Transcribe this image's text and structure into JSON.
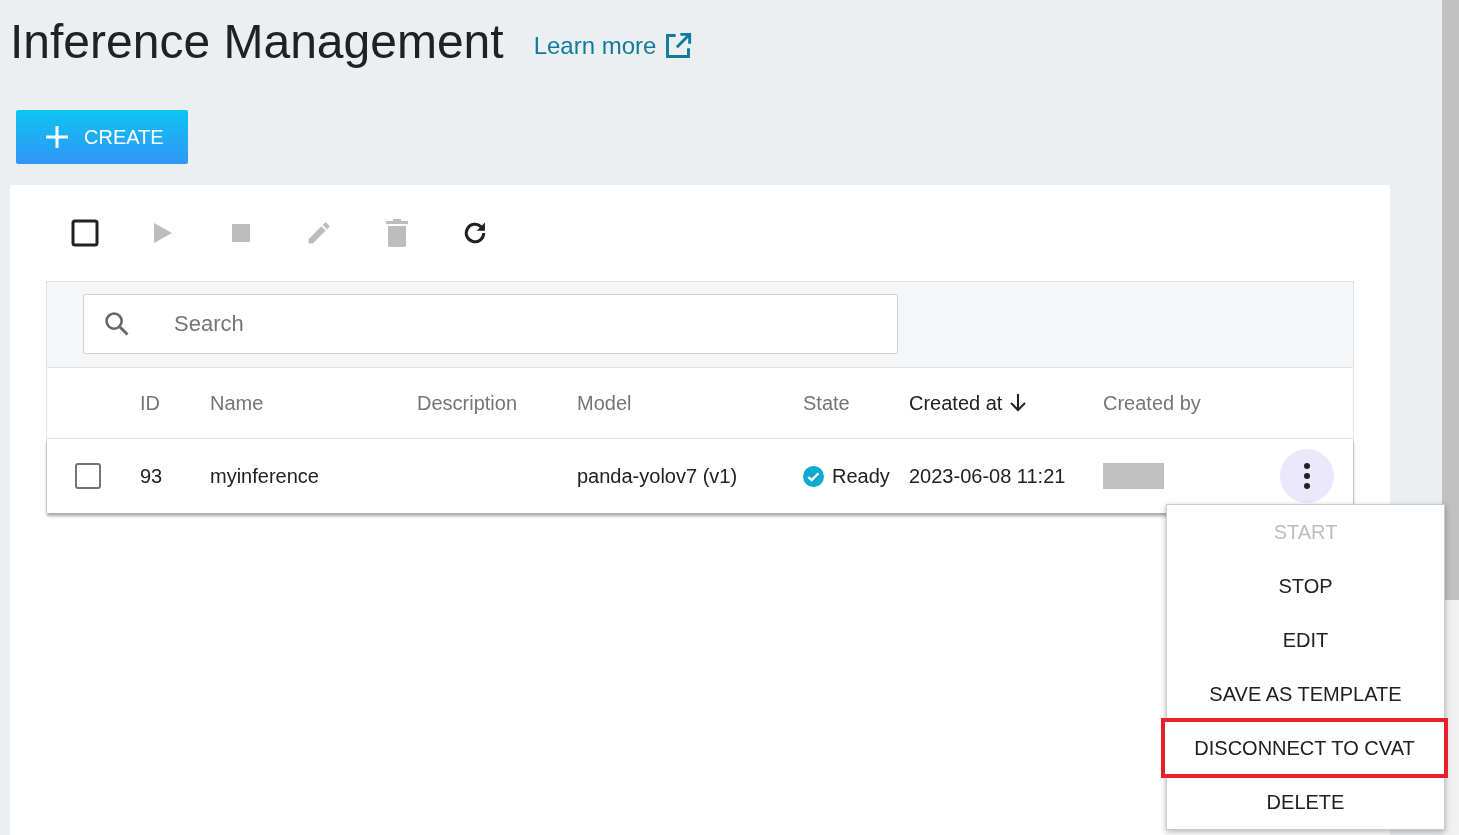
{
  "page": {
    "title": "Inference Management",
    "learn_more": "Learn more"
  },
  "create_button": {
    "label": "CREATE"
  },
  "toolbar": [
    {
      "kind": "checkbox",
      "disabled": false
    },
    {
      "kind": "start",
      "disabled": true
    },
    {
      "kind": "stop",
      "disabled": true
    },
    {
      "kind": "edit",
      "disabled": true
    },
    {
      "kind": "delete",
      "disabled": true
    },
    {
      "kind": "refresh",
      "disabled": false
    }
  ],
  "search": {
    "placeholder": "Search"
  },
  "table": {
    "columns": [
      {
        "label": "ID",
        "sorted": false
      },
      {
        "label": "Name",
        "sorted": false
      },
      {
        "label": "Description",
        "sorted": false
      },
      {
        "label": "Model",
        "sorted": false
      },
      {
        "label": "State",
        "sorted": false
      },
      {
        "label": "Created at",
        "sorted": true
      },
      {
        "label": "Created by",
        "sorted": false
      }
    ],
    "rows": [
      {
        "checked": false,
        "id": "93",
        "name": "myinference",
        "model": "panda-yolov7 (v1)",
        "state": {
          "label": "Ready",
          "success": true
        },
        "created_at": "2023-06-08 11:21",
        "menu_open": true
      }
    ]
  },
  "context_menu": [
    {
      "label": "START",
      "disabled": true,
      "outlined": false
    },
    {
      "label": "STOP",
      "disabled": false,
      "outlined": false
    },
    {
      "label": "EDIT",
      "disabled": false,
      "outlined": false
    },
    {
      "label": "SAVE AS TEMPLATE",
      "disabled": false,
      "outlined": false
    },
    {
      "label": "DISCONNECT TO CVAT",
      "disabled": false,
      "outlined": true
    },
    {
      "label": "DELETE",
      "disabled": false,
      "outlined": false
    }
  ]
}
